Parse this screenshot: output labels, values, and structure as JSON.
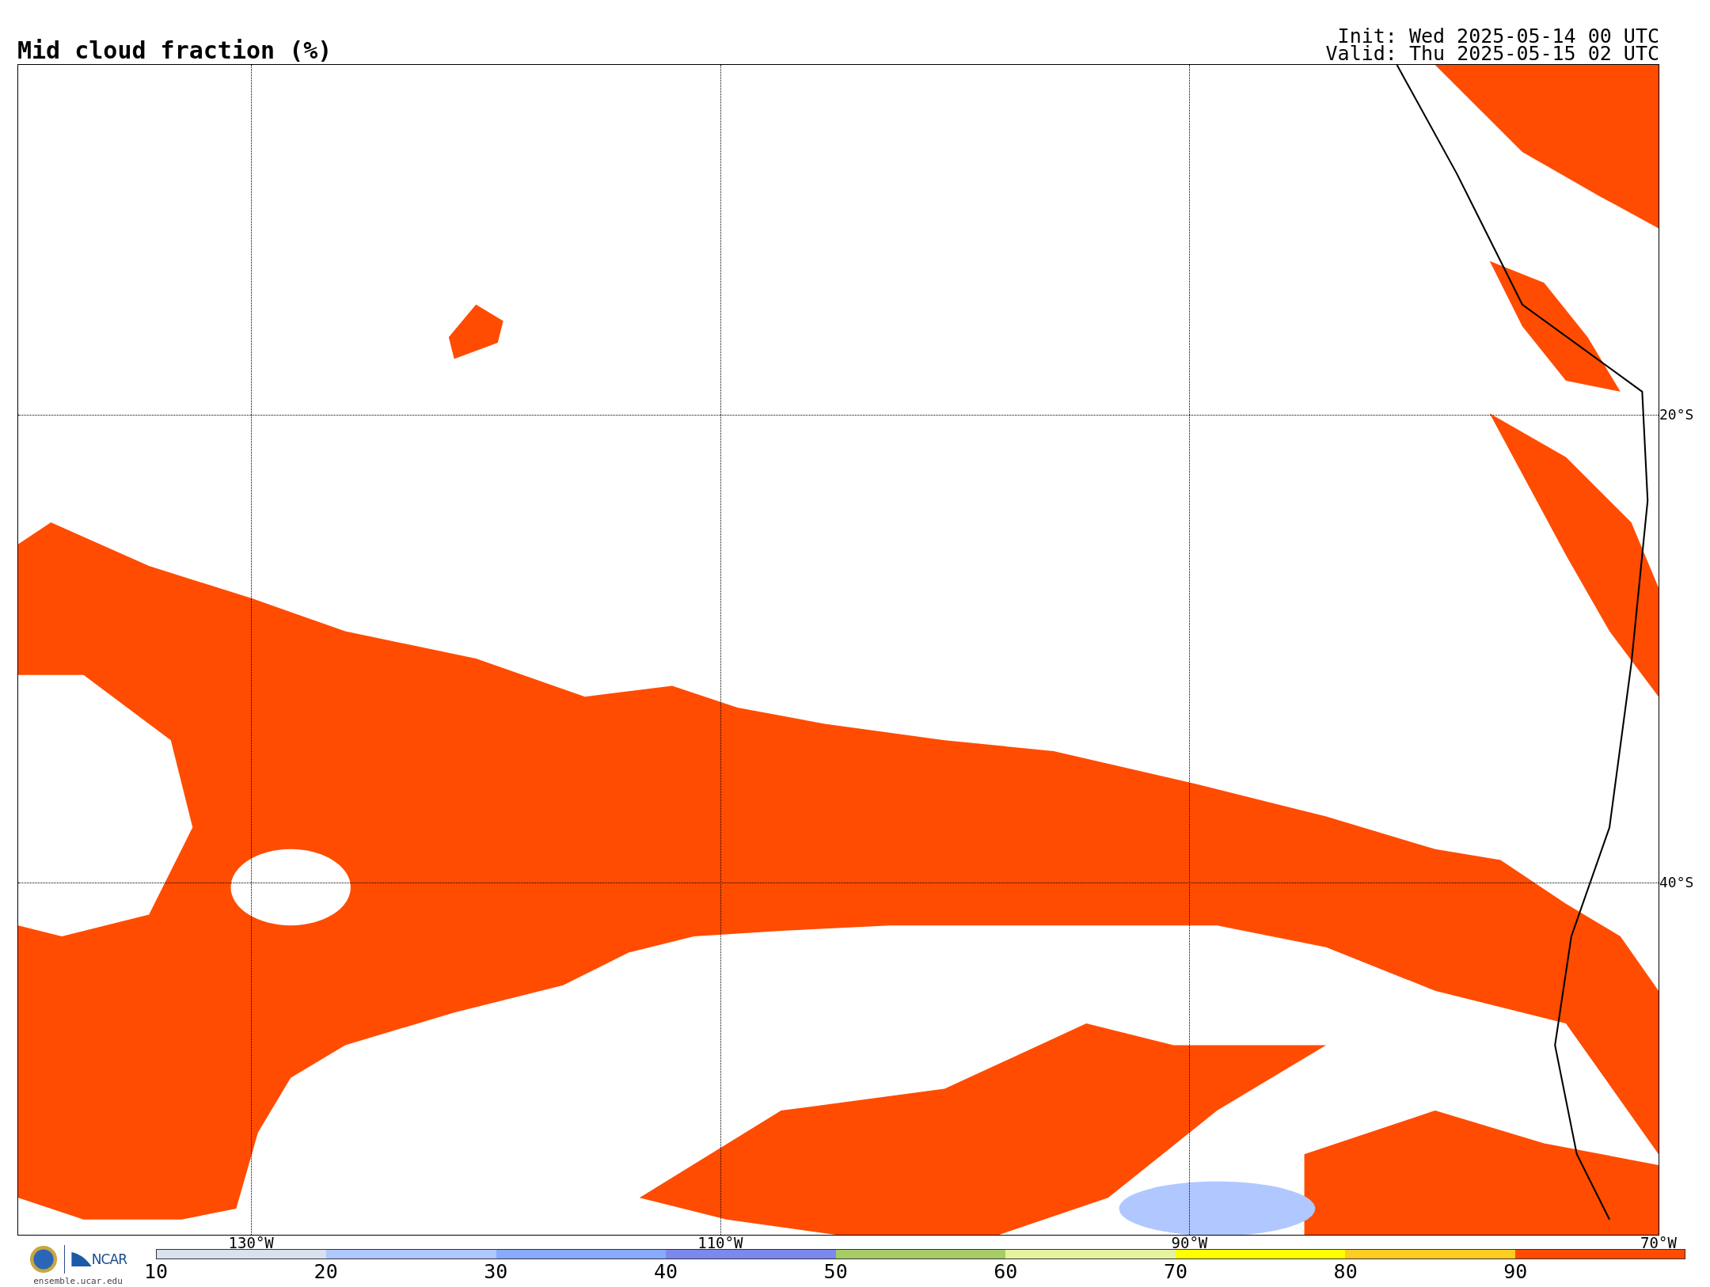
{
  "title": "Mid cloud fraction (%)",
  "init": "Init: Wed 2025-05-14 00 UTC",
  "valid": "Valid: Thu 2025-05-15 02 UTC",
  "map": {
    "lat_labels": [
      "20°S",
      "40°S"
    ],
    "lon_labels": [
      "130°W",
      "110°W",
      "90°W",
      "70°W"
    ]
  },
  "logo": {
    "name": "NCAR",
    "url": "ensemble.ucar.edu"
  },
  "colorbar": {
    "ticks": [
      "10",
      "20",
      "30",
      "40",
      "50",
      "60",
      "70",
      "80",
      "90"
    ],
    "bins": [
      {
        "color": "#d8e2ee"
      },
      {
        "color": "#b0c8ff"
      },
      {
        "color": "#88aaff"
      },
      {
        "color": "#7a88f0"
      },
      {
        "color": "#a6cc66"
      },
      {
        "color": "#e6f2a0"
      },
      {
        "color": "#ffff00"
      },
      {
        "color": "#ffcc22"
      },
      {
        "color": "#ff4c00"
      }
    ]
  }
}
